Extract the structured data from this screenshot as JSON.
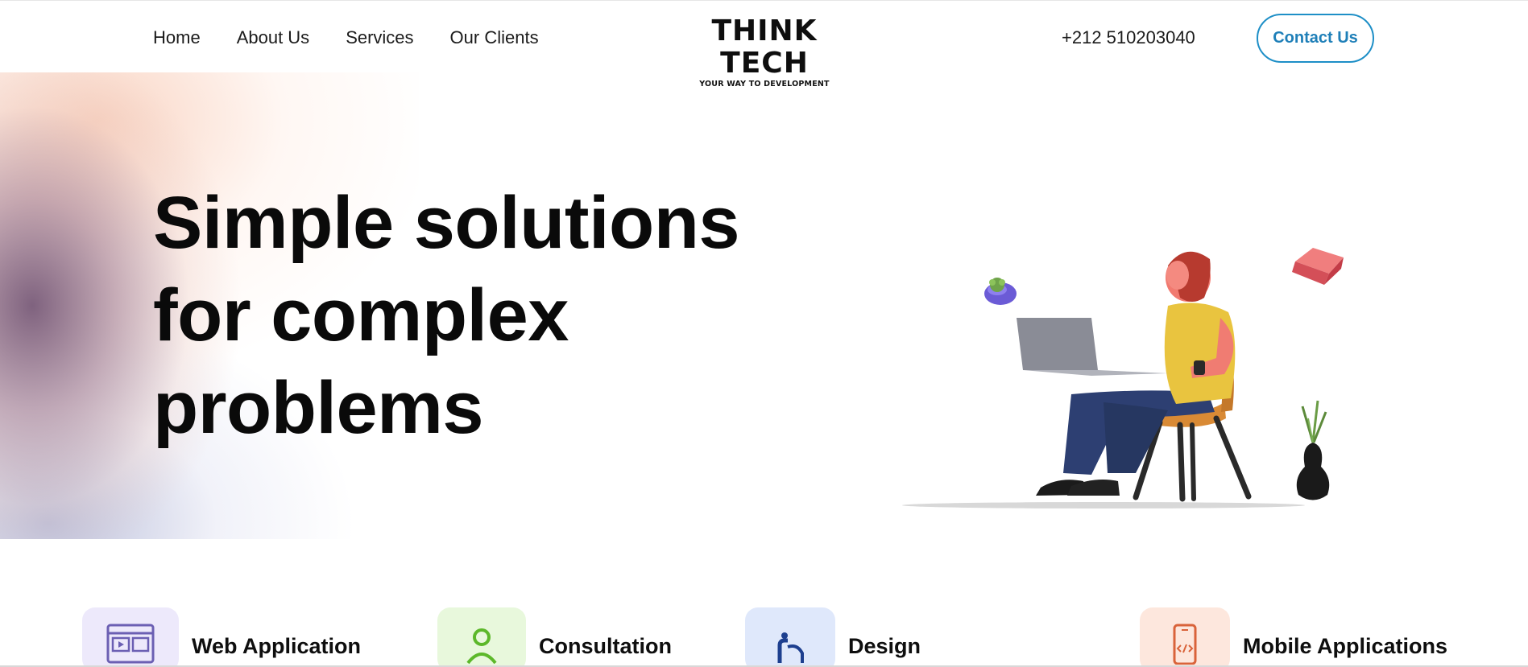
{
  "nav": {
    "items": [
      {
        "label": "Home"
      },
      {
        "label": "About Us"
      },
      {
        "label": "Services"
      },
      {
        "label": "Our Clients"
      }
    ]
  },
  "logo": {
    "main": "THINK TECH",
    "tagline": "YOUR WAY TO DEVELOPMENT"
  },
  "header": {
    "phone": "+212 510203040",
    "contact_label": "Contact Us"
  },
  "hero": {
    "lines": [
      "Simple solutions",
      "for complex",
      "problems"
    ]
  },
  "services": [
    {
      "label": "Web Application",
      "icon": "web-app-icon",
      "bg": "#ede9fb"
    },
    {
      "label": "Consultation",
      "icon": "consultation-icon",
      "bg": "#e8f8dc"
    },
    {
      "label": "Design",
      "icon": "design-icon",
      "bg": "#dfe8fb"
    },
    {
      "label": "Mobile Applications",
      "icon": "mobile-code-icon",
      "bg": "#fde7dd"
    }
  ],
  "colors": {
    "accent": "#1e8fc7",
    "text": "#0a0a0a"
  }
}
